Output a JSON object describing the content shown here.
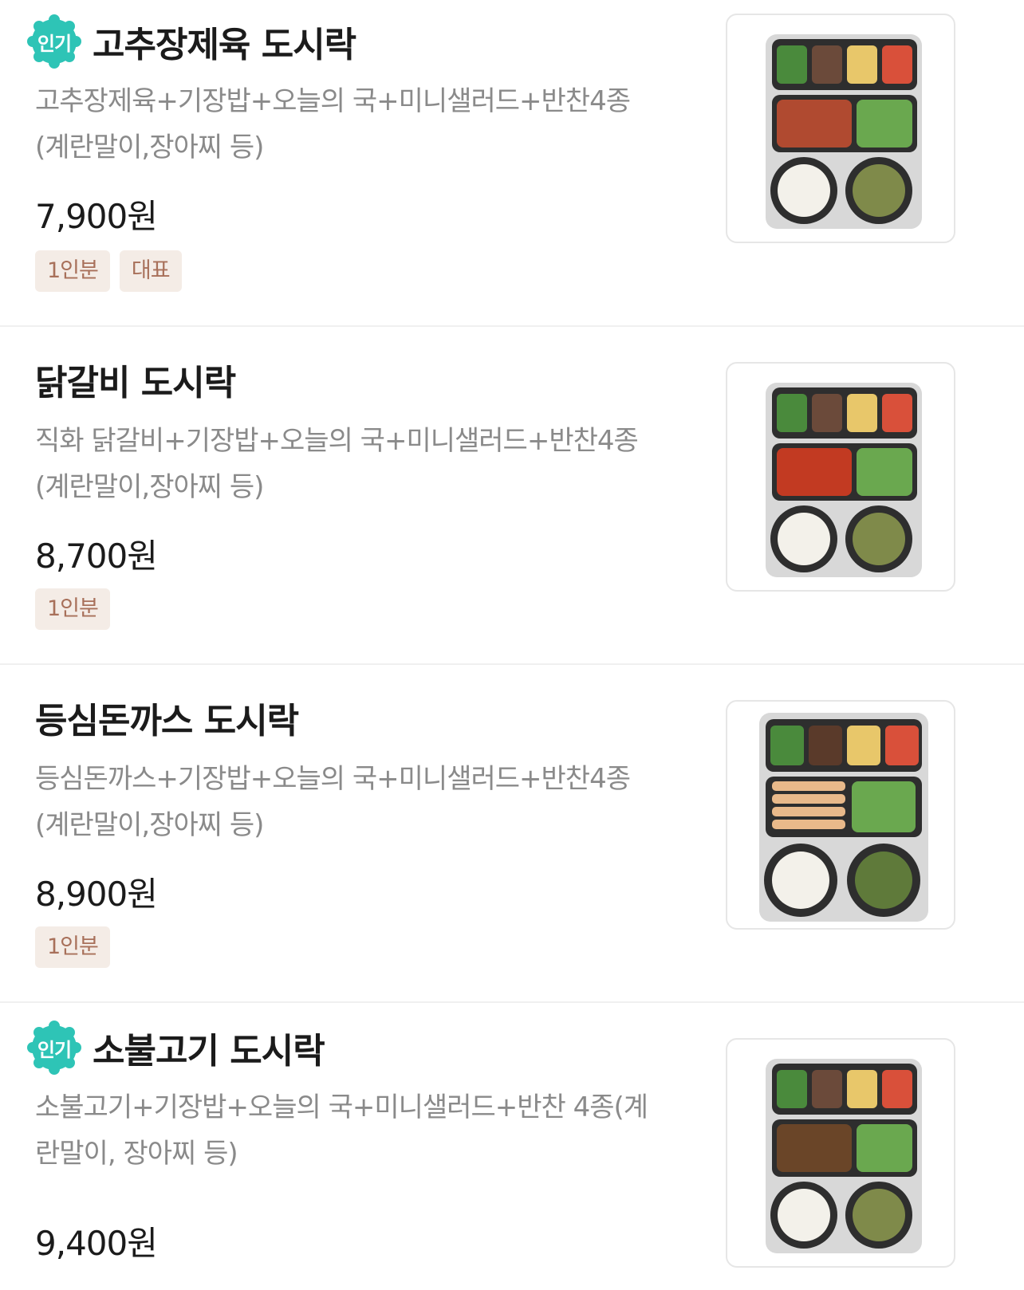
{
  "popular_badge_label": "인기",
  "colors": {
    "badge": "#2ec4b6",
    "tag_bg": "#f4ece6",
    "tag_text": "#a8705a"
  },
  "menu": [
    {
      "popular": true,
      "name": "고추장제육 도시락",
      "desc_line1": "고추장제육+기장밥+오늘의 국+미니샐러드+반찬4종",
      "desc_line2": "(계란말이,장아찌 등)",
      "price": "7,900원",
      "tags": [
        "1인분",
        "대표"
      ],
      "image": "lunchbox-spicy-pork-icon"
    },
    {
      "popular": false,
      "name": "닭갈비 도시락",
      "desc_line1": "직화 닭갈비+기장밥+오늘의 국+미니샐러드+반찬4종",
      "desc_line2": "(계란말이,장아찌 등)",
      "price": "8,700원",
      "tags": [
        "1인분"
      ],
      "image": "lunchbox-dakgalbi-icon"
    },
    {
      "popular": false,
      "name": "등심돈까스 도시락",
      "desc_line1": "등심돈까스+기장밥+오늘의 국+미니샐러드+반찬4종",
      "desc_line2": "(계란말이,장아찌 등)",
      "price": "8,900원",
      "tags": [
        "1인분"
      ],
      "image": "lunchbox-pork-cutlet-icon"
    },
    {
      "popular": true,
      "name": "소불고기 도시락",
      "desc_line1": "소불고기+기장밥+오늘의 국+미니샐러드+반찬 4종(계",
      "desc_line2": "란말이, 장아찌 등)",
      "price": "9,400원",
      "tags": [],
      "image": "lunchbox-bulgogi-icon"
    }
  ]
}
